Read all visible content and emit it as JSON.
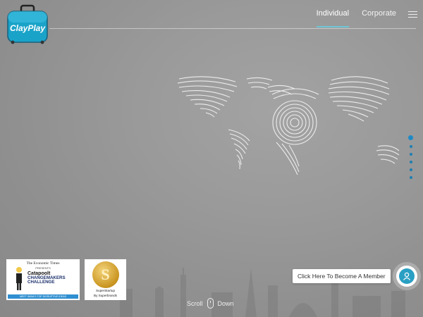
{
  "brand": {
    "name": "ClayPlay",
    "logo_color": "#1aa3c9"
  },
  "nav": {
    "items": [
      {
        "label": "Individual",
        "active": true
      },
      {
        "label": "Corporate",
        "active": false
      }
    ],
    "menu_icon": "hamburger-icon",
    "accent": "#6ec6d6"
  },
  "pagination": {
    "count": 6,
    "active_index": 0,
    "color": "#1e8ac5"
  },
  "badges": {
    "et": {
      "header": "The Economic Times",
      "presents": "PRESENTS",
      "catapoolt": "Catapoolt",
      "challenge_line1": "CHANGEMAKERS",
      "challenge_line2": "CHALLENGE",
      "footer": "MEET INDIA'S TOP DISRUPTIVE IDEAS"
    },
    "superstartup": {
      "coin_letter": "S",
      "line1": "SuperStartup",
      "line2": "By Superbrands"
    }
  },
  "scroll": {
    "left": "Scroll",
    "right": "Down"
  },
  "member": {
    "label": "Click Here To Become A Member",
    "icon": "user-icon",
    "color": "#2a9fc4"
  }
}
